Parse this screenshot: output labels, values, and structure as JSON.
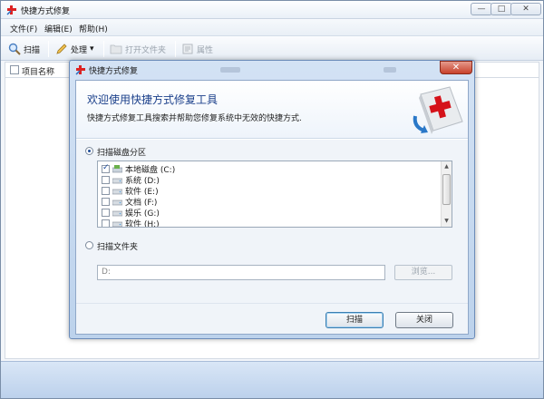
{
  "window": {
    "title": "快捷方式修复",
    "min": "—",
    "max": "□",
    "close": "✕"
  },
  "menu": {
    "file": "文件(F)",
    "edit": "编辑(E)",
    "help": "帮助(H)"
  },
  "toolbar": {
    "scan": "扫描",
    "process": "处理",
    "process_arrow": "▾",
    "open_folder": "打开文件夹",
    "properties": "属性"
  },
  "list": {
    "column_name": "项目名称"
  },
  "dialog": {
    "title": "快捷方式修复",
    "close": "✕",
    "banner_title": "欢迎使用快捷方式修复工具",
    "banner_subtitle": "快捷方式修复工具搜索并帮助您修复系统中无效的快捷方式.",
    "option_disk": "扫描磁盘分区",
    "option_folder": "扫描文件夹",
    "drives": [
      {
        "label": "本地磁盘 (C:)",
        "checked": true
      },
      {
        "label": "系统 (D:)",
        "checked": false
      },
      {
        "label": "软件 (E:)",
        "checked": false
      },
      {
        "label": "文档 (F:)",
        "checked": false
      },
      {
        "label": "娱乐 (G:)",
        "checked": false
      },
      {
        "label": "软件 (H:)",
        "checked": false
      }
    ],
    "folder_path": "D:",
    "browse": "浏览...",
    "scan_button": "扫描",
    "close_button": "关闭"
  },
  "colors": {
    "accent": "#1a3f8a",
    "dialog_frame": "#bcd2ec",
    "close_red": "#c8412b"
  }
}
